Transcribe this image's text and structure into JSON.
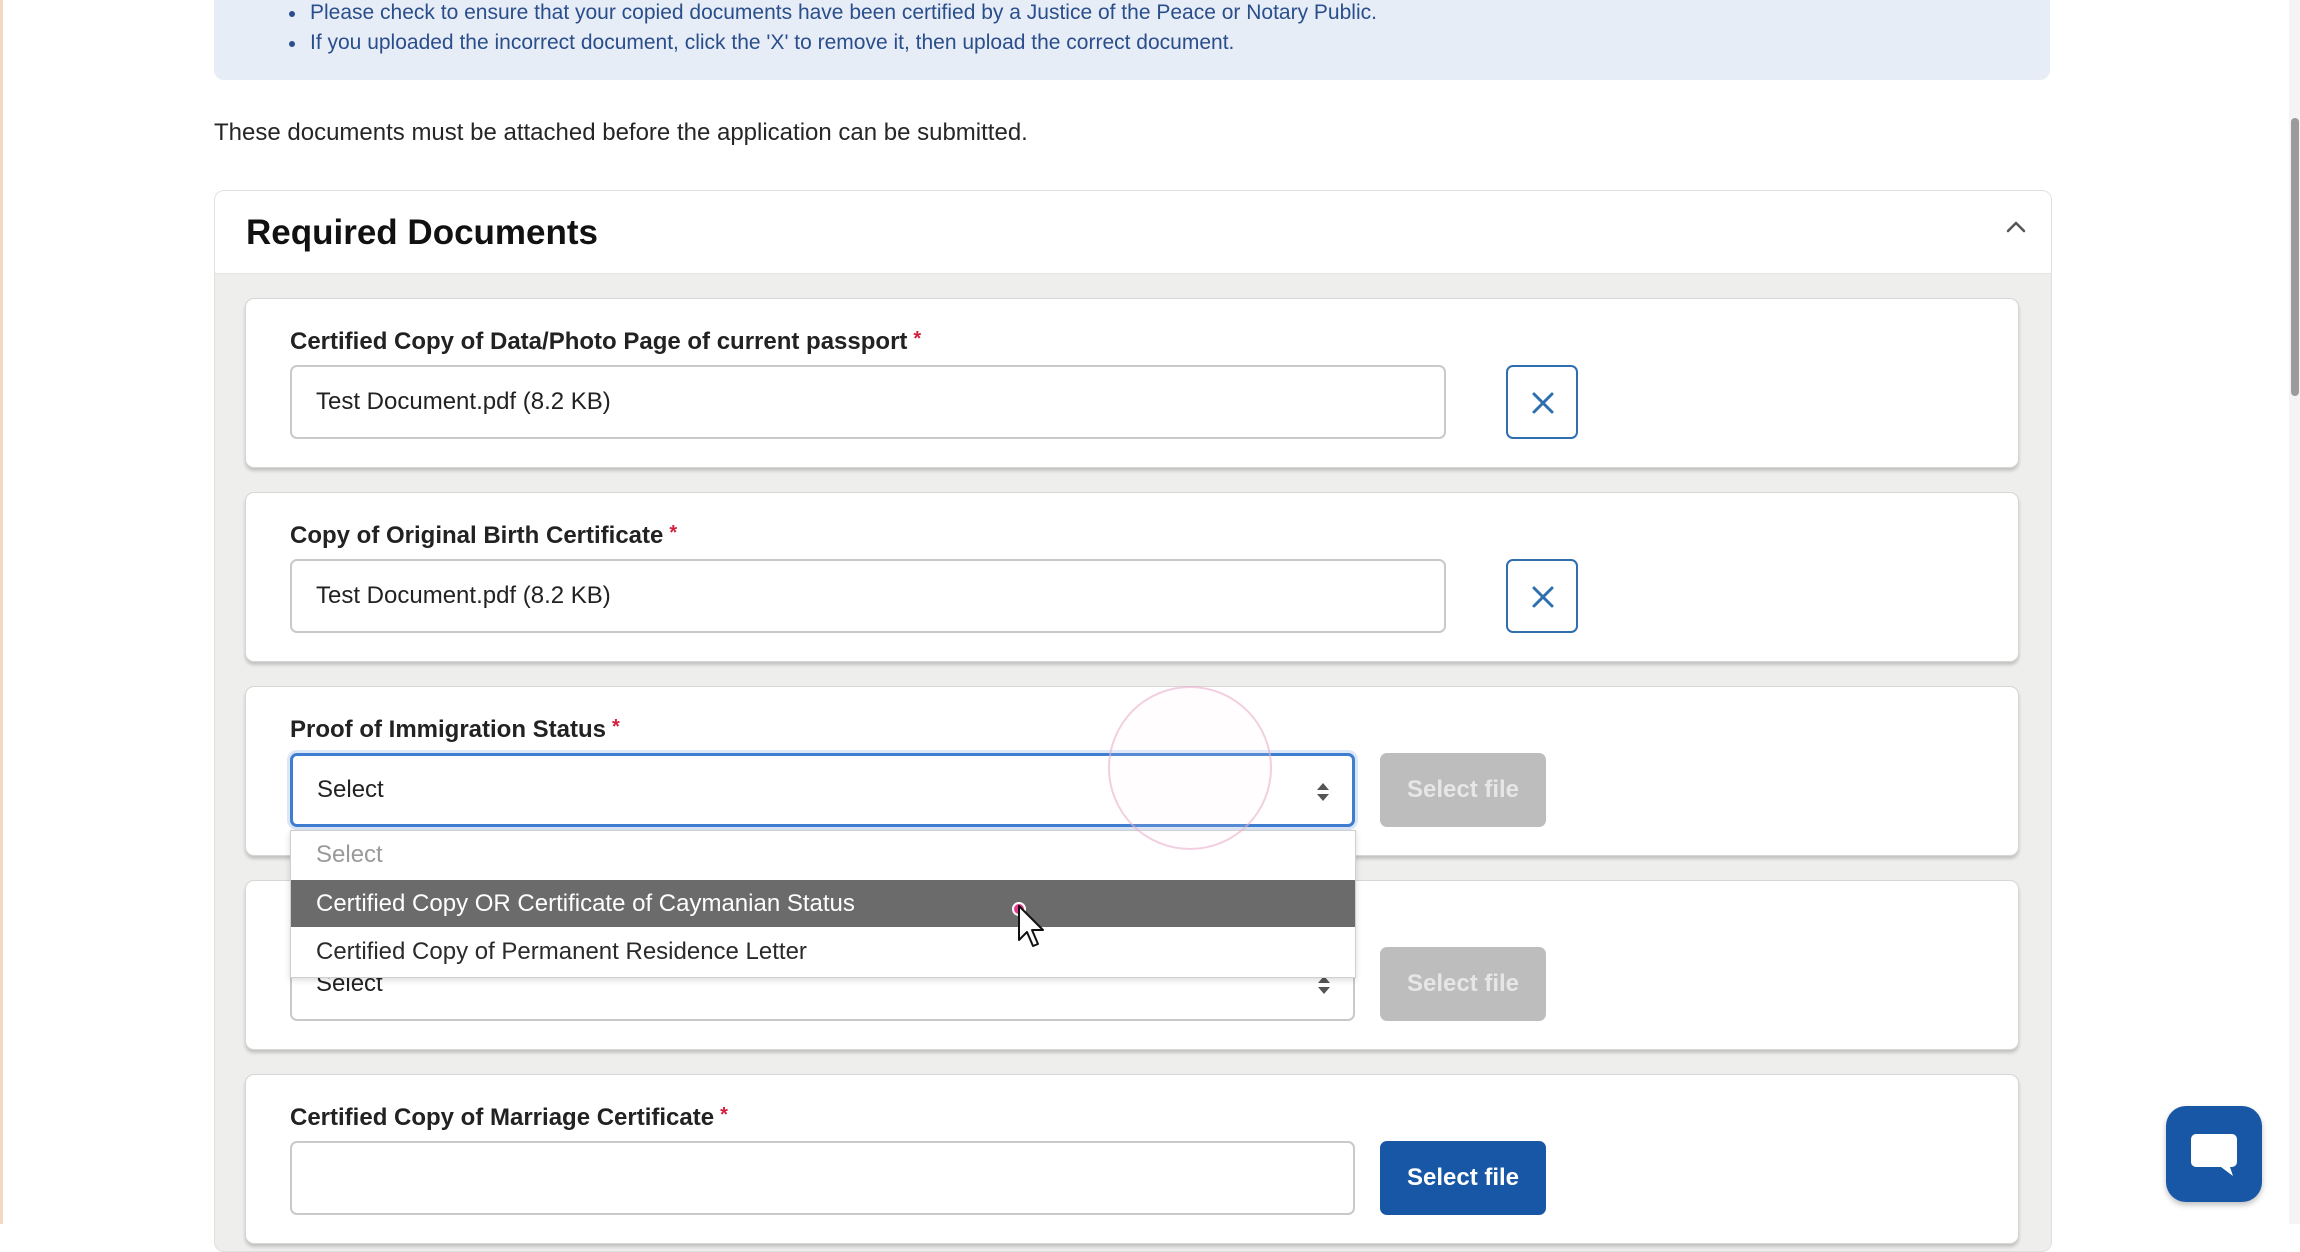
{
  "instructions": {
    "items": [
      "Please check to ensure that your copied documents have been certified by a Justice of the Peace or Notary Public.",
      "If you uploaded the incorrect document, click the 'X' to remove it, then upload the correct document."
    ]
  },
  "intro_text": "These documents must be attached before the application can be submitted.",
  "section": {
    "title": "Required Documents",
    "collapse_icon": "chevron-up-icon"
  },
  "required_marker": "*",
  "documents": [
    {
      "label": "Certified Copy of Data/Photo Page of current passport",
      "file": "Test Document.pdf (8.2 KB)",
      "remove_icon": "close-icon"
    },
    {
      "label": "Copy of Original Birth Certificate",
      "file": "Test Document.pdf (8.2 KB)",
      "remove_icon": "close-icon"
    },
    {
      "label": "Proof of Immigration Status",
      "select_value": "Select",
      "button": "Select file"
    },
    {
      "select_value": "Select",
      "button": "Select file"
    },
    {
      "label": "Certified Copy of Marriage Certificate",
      "button": "Select file"
    }
  ],
  "dropdown": {
    "options": [
      "Select",
      "Certified Copy OR Certificate of Caymanian Status",
      "Certified Copy of Permanent Residence Letter"
    ],
    "highlighted": "Certified Copy OR Certificate of Caymanian Status"
  },
  "colors": {
    "primary": "#1757a6",
    "required": "#d21f3c",
    "info_background": "#e7edf6",
    "info_text": "#2a4e8c",
    "highlight": "#6b6b6b"
  },
  "chat": {
    "icon": "chat-bubble-icon"
  }
}
